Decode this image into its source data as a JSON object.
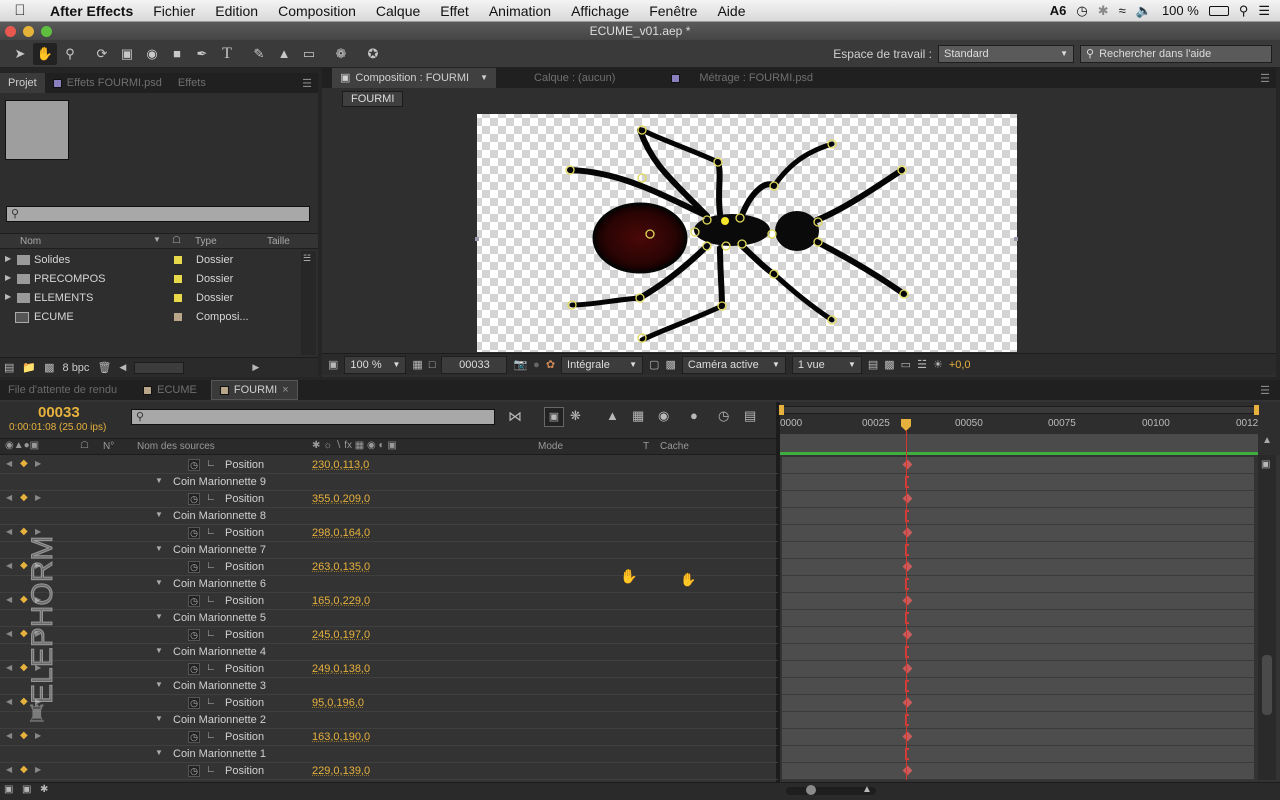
{
  "menubar": {
    "app": "After Effects",
    "items": [
      "Fichier",
      "Edition",
      "Composition",
      "Calque",
      "Effet",
      "Animation",
      "Affichage",
      "Fenêtre",
      "Aide"
    ],
    "adobe_badge": "6",
    "battery": "100 %"
  },
  "window": {
    "title": "ECUME_v01.aep *"
  },
  "toolbar": {
    "workspace_label": "Espace de travail :",
    "workspace_value": "Standard",
    "help_placeholder": "Rechercher dans l'aide"
  },
  "project": {
    "tabs": [
      "Projet",
      "Effets FOURMI.psd",
      "Effets"
    ],
    "columns": {
      "name": "Nom",
      "type": "Type",
      "size": "Taille"
    },
    "items": [
      {
        "name": "Solides",
        "type": "Dossier",
        "color": "#e8d94a"
      },
      {
        "name": "PRECOMPOS",
        "type": "Dossier",
        "color": "#e8d94a"
      },
      {
        "name": "ELEMENTS",
        "type": "Dossier",
        "color": "#e8d94a"
      },
      {
        "name": "ECUME",
        "type": "Composi...",
        "color": "#b8a58a"
      }
    ],
    "bpc": "8 bpc"
  },
  "viewer": {
    "tabs": [
      "Composition : FOURMI",
      "Calque : (aucun)",
      "Métrage : FOURMI.psd"
    ],
    "comp_chip": "FOURMI",
    "zoom": "100 %",
    "frame": "00033",
    "quality": "Intégrale",
    "camera": "Caméra active",
    "views": "1 vue",
    "exposure": "+0,0"
  },
  "timeline": {
    "tabs": [
      "File d'attente de rendu",
      "ECUME",
      "FOURMI"
    ],
    "current_frame": "00033",
    "current_time": "0:00:01:08 (25.00 ips)",
    "columns": {
      "num": "N°",
      "source": "Nom des sources",
      "mode": "Mode",
      "t": "T",
      "cache": "Cache"
    },
    "ruler": [
      "0000",
      "00025",
      "00050",
      "00075",
      "00100",
      "0012"
    ],
    "rows": [
      {
        "kind": "prop",
        "label": "Position",
        "value": "230,0,113,0"
      },
      {
        "kind": "group",
        "label": "Coin Marionnette 9"
      },
      {
        "kind": "prop",
        "label": "Position",
        "value": "355,0,209,0"
      },
      {
        "kind": "group",
        "label": "Coin Marionnette 8"
      },
      {
        "kind": "prop",
        "label": "Position",
        "value": "298,0,164,0"
      },
      {
        "kind": "group",
        "label": "Coin Marionnette 7"
      },
      {
        "kind": "prop",
        "label": "Position",
        "value": "263,0,135,0"
      },
      {
        "kind": "group",
        "label": "Coin Marionnette 6"
      },
      {
        "kind": "prop",
        "label": "Position",
        "value": "165,0,229,0"
      },
      {
        "kind": "group",
        "label": "Coin Marionnette 5"
      },
      {
        "kind": "prop",
        "label": "Position",
        "value": "245,0,197,0"
      },
      {
        "kind": "group",
        "label": "Coin Marionnette 4"
      },
      {
        "kind": "prop",
        "label": "Position",
        "value": "249,0,138,0"
      },
      {
        "kind": "group",
        "label": "Coin Marionnette 3"
      },
      {
        "kind": "prop",
        "label": "Position",
        "value": "95,0,196,0"
      },
      {
        "kind": "group",
        "label": "Coin Marionnette 2"
      },
      {
        "kind": "prop",
        "label": "Position",
        "value": "163,0,190,0"
      },
      {
        "kind": "group",
        "label": "Coin Marionnette 1"
      },
      {
        "kind": "prop",
        "label": "Position",
        "value": "229,0,139,0"
      }
    ]
  },
  "watermark": "ELEPHORM"
}
